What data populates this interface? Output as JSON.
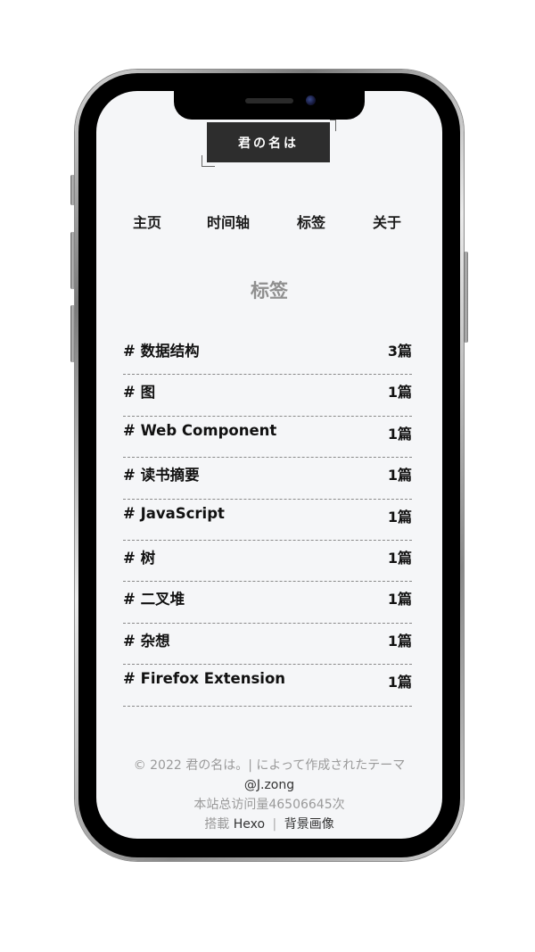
{
  "site": {
    "logo_text": "君の名は"
  },
  "nav": {
    "items": [
      {
        "label": "主页"
      },
      {
        "label": "时间轴"
      },
      {
        "label": "标签"
      },
      {
        "label": "关于"
      }
    ]
  },
  "page": {
    "title": "标签"
  },
  "tags": [
    {
      "name": "# 数据结构",
      "count": "3篇"
    },
    {
      "name": "# 图",
      "count": "1篇"
    },
    {
      "name": "# Web Component",
      "count": "1篇"
    },
    {
      "name": "# 读书摘要",
      "count": "1篇"
    },
    {
      "name": "# JavaScript",
      "count": "1篇"
    },
    {
      "name": "# 树",
      "count": "1篇"
    },
    {
      "name": "# 二叉堆",
      "count": "1篇"
    },
    {
      "name": "# 杂想",
      "count": "1篇"
    },
    {
      "name": "# Firefox Extension",
      "count": "1篇"
    }
  ],
  "footer": {
    "copyright": "© 2022 君の名は。| によって作成されたテーマ",
    "author": "@J.zong",
    "visits": "本站总访问量46506645次",
    "powered_prefix": "搭載",
    "powered_link": "Hexo",
    "separator": "|",
    "background_link": "背景画像"
  },
  "colors": {
    "screen_bg": "#f5f6f8",
    "logo_bg": "#2d2d2d",
    "title_gray": "#8f8f8f",
    "footer_gray": "#9a9a9a"
  }
}
